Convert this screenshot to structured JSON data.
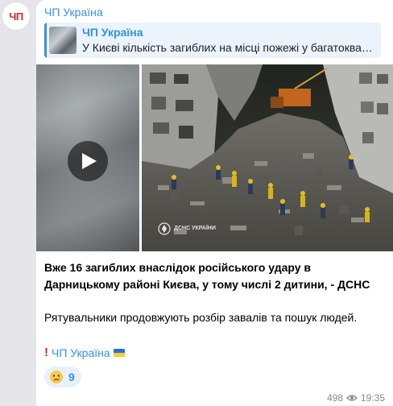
{
  "channel": {
    "avatar_text": "ЧП",
    "name": "ЧП Україна"
  },
  "reply": {
    "title": "ЧП Україна",
    "text": "У Києві кількість загиблих на місці пожежі у багатоквартирному будинку"
  },
  "media": {
    "video_play_icon": "play-icon",
    "watermark_text": "ДСНС УКРАЇНИ"
  },
  "post": {
    "headline": "Вже 16 загиблих внаслідок російського удару в Дарницькому районі Києва, у тому числі 2 дитини, - ДСНС",
    "body": "Рятувальники продовжують розбір завалів та пошук людей.",
    "signature": "ЧП Україна"
  },
  "reactions": [
    {
      "emoji": "😢",
      "count": "9"
    }
  ],
  "meta": {
    "views": "498",
    "time": "19:35"
  },
  "colors": {
    "accent": "#3390ec",
    "brand_red": "#d6262b",
    "background": "#e5e5ea"
  }
}
